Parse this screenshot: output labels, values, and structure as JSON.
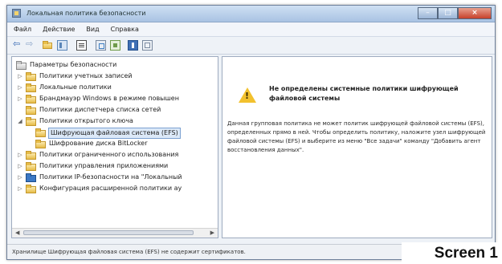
{
  "window": {
    "title": "Локальная политика безопасности",
    "controls": {
      "minimize": "–",
      "maximize": "□",
      "close": "×"
    }
  },
  "menu": [
    "Файл",
    "Действие",
    "Вид",
    "Справка"
  ],
  "toolbar": {
    "icons": [
      "back-arrow-icon",
      "forward-arrow-icon",
      "folder-up-icon",
      "console-tree-icon",
      "document-icon",
      "export-list-icon",
      "properties-icon",
      "help-icon",
      "view-icon"
    ],
    "back_glyph": "⇦",
    "forward_glyph": "⇨"
  },
  "tree": {
    "items": [
      {
        "label": "Параметры безопасности",
        "expander": "",
        "icon": "root"
      },
      {
        "label": "Политики учетных записей",
        "expander": "▷",
        "icon": "folder"
      },
      {
        "label": "Локальные политики",
        "expander": "▷",
        "icon": "folder"
      },
      {
        "label": "Брандмауэр Windows в режиме повышен",
        "expander": "▷",
        "icon": "folder"
      },
      {
        "label": "Политики диспетчера списка сетей",
        "expander": "",
        "icon": "folder"
      },
      {
        "label": "Политики открытого ключа",
        "expander": "◢",
        "icon": "folder"
      },
      {
        "label": "Шифрующая файловая система (EFS)",
        "expander": "",
        "icon": "folder",
        "selected": true
      },
      {
        "label": "Шифрование диска BitLocker",
        "expander": "",
        "icon": "folder"
      },
      {
        "label": "Политики ограниченного использования",
        "expander": "▷",
        "icon": "folder"
      },
      {
        "label": "Политики управления приложениями",
        "expander": "▷",
        "icon": "folder"
      },
      {
        "label": "Политики IP-безопасности на \"Локальный",
        "expander": "▷",
        "icon": "net"
      },
      {
        "label": "Конфигурация расширенной политики ау",
        "expander": "▷",
        "icon": "folder"
      }
    ],
    "scroll_left": "◀",
    "scroll_right": "▶"
  },
  "detail": {
    "title": "Не определены системные политики шифрующей файловой системы",
    "body": "Данная групповая политика не может политик шифрующей файловой системы (EFS), определенных прямо в ней. Чтобы определить политику, наложите узел шифрующей файловой системы (EFS) и выберите из меню \"Все задачи\" команду \"Добавить агент восстановления данных\"."
  },
  "status": {
    "text": "Хранилище Шифрующая файловая система (EFS) не содержит сертификатов."
  },
  "caption": "Screen 1",
  "colors": {
    "selection": "#dce9f8",
    "selection_border": "#7ca1d1",
    "close_button": "#c6412b",
    "warning": "#f2c12e"
  }
}
